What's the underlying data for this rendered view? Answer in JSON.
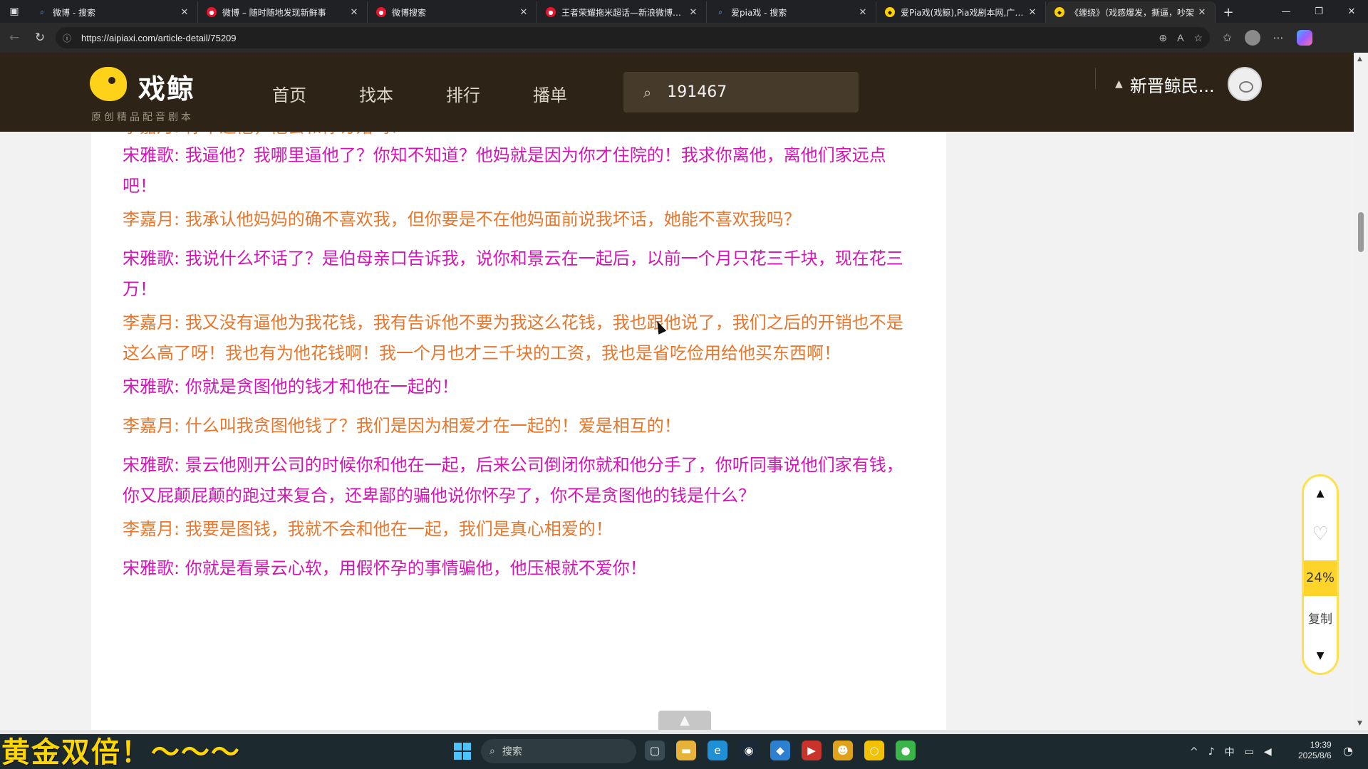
{
  "browser": {
    "tabs": [
      {
        "title": "微博 - 搜索",
        "favicon": "search-icon"
      },
      {
        "title": "微博 – 随时随地发现新鲜事",
        "favicon": "weibo-icon"
      },
      {
        "title": "微博搜索",
        "favicon": "weibo-icon"
      },
      {
        "title": "王者荣耀拖米超话—新浪微博超话",
        "favicon": "weibo-icon"
      },
      {
        "title": "爱pia戏 - 搜索",
        "favicon": "search-icon"
      },
      {
        "title": "爱Pia戏(戏鲸),Pia戏剧本网,广播剧",
        "favicon": "pia-icon"
      },
      {
        "title": "《缠绕》（戏感爆发，撕逼，吵架",
        "favicon": "pia-icon",
        "active": true
      }
    ],
    "new_tab": "+",
    "url": "https://aipiaxi.com/article-detail/75209"
  },
  "site": {
    "logo_name": "戏鲸",
    "logo_tagline": "原创精品配音剧本",
    "nav": [
      "首页",
      "找本",
      "排行",
      "播单"
    ],
    "search_value": "191467",
    "user_name": "新晋鲸民..."
  },
  "article": {
    "lines": [
      {
        "speaker": "李嘉月",
        "text": "你不逼他，他会和你订婚吗？",
        "color": "#e8762b"
      },
      {
        "speaker": "宋雅歌",
        "text": "我逼他？我哪里逼他了？你知不知道？他妈就是因为你才住院的！我求你离他，离他们家远点吧！",
        "color": "#d415b6"
      },
      {
        "speaker": "李嘉月",
        "text": "我承认他妈妈的确不喜欢我，但你要是不在他妈面前说我坏话，她能不喜欢我吗？",
        "color": "#e8762b"
      },
      {
        "speaker": "宋雅歌",
        "text": "我说什么坏话了？是伯母亲口告诉我，说你和景云在一起后，以前一个月只花三千块，现在花三万！",
        "color": "#d415b6"
      },
      {
        "speaker": "李嘉月",
        "text": "我又没有逼他为我花钱，我有告诉他不要为我这么花钱，我也跟他说了，我们之后的开销也不是这么高了呀！我也有为他花钱啊！我一个月也才三千块的工资，我也是省吃俭用给他买东西啊！",
        "color": "#e8762b"
      },
      {
        "speaker": "宋雅歌",
        "text": "你就是贪图他的钱才和他在一起的！",
        "color": "#d415b6"
      },
      {
        "speaker": "李嘉月",
        "text": "什么叫我贪图他钱了？我们是因为相爱才在一起的！爱是相互的！",
        "color": "#e8762b"
      },
      {
        "speaker": "宋雅歌",
        "text": "景云他刚开公司的时候你和他在一起，后来公司倒闭你就和他分手了，你听同事说他们家有钱，你又屁颠屁颠的跑过来复合，还卑鄙的骗他说你怀孕了，你不是贪图他的钱是什么？",
        "color": "#d415b6"
      },
      {
        "speaker": "李嘉月",
        "text": "我要是图钱，我就不会和他在一起，我们是真心相爱的！",
        "color": "#e8762b"
      },
      {
        "speaker": "宋雅歌",
        "text": "你就是看景云心软，用假怀孕的事情骗他，他压根就不爱你！",
        "color": "#d415b6"
      }
    ]
  },
  "widget": {
    "progress": "24%",
    "copy_label": "复制"
  },
  "taskbar": {
    "ticker": "黄金双倍！～～～",
    "search_placeholder": "搜索",
    "ime": "中",
    "time": "19:39",
    "date": "2025/8/6"
  }
}
